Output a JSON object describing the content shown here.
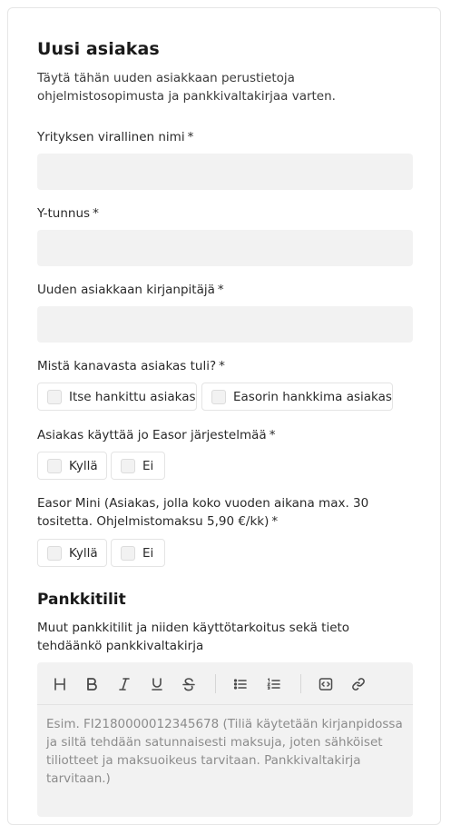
{
  "form": {
    "title": "Uusi asiakas",
    "description": "Täytä tähän uuden asiakkaan perustietoja ohjelmistosopimusta ja pankkivaltakirjaa varten.",
    "required_mark": "*",
    "fields": {
      "company_name": {
        "label": "Yrityksen virallinen nimi",
        "value": ""
      },
      "business_id": {
        "label": "Y-tunnus",
        "value": ""
      },
      "bookkeeper": {
        "label": "Uuden asiakkaan kirjanpitäjä",
        "value": ""
      }
    },
    "channel": {
      "label": "Mistä kanavasta asiakas tuli?",
      "options": [
        "Itse hankittu asiakas",
        "Easorin hankkima asiakas"
      ]
    },
    "uses_easor": {
      "label": "Asiakas käyttää jo Easor järjestelmää",
      "options": [
        "Kyllä",
        "Ei"
      ]
    },
    "easor_mini": {
      "label": "Easor Mini (Asiakas, jolla koko vuoden aikana max. 30 tositetta. Ohjelmistomaksu 5,90 €/kk)",
      "options": [
        "Kyllä",
        "Ei"
      ]
    }
  },
  "bank": {
    "title": "Pankkitilit",
    "label": "Muut pankkitilit ja niiden käyttötarkoitus sekä tieto tehdäänkö pankkivaltakirja",
    "toolbar": [
      "heading-icon",
      "bold-icon",
      "italic-icon",
      "underline-icon",
      "strikethrough-icon",
      "bullet-list-icon",
      "numbered-list-icon",
      "code-block-icon",
      "link-icon"
    ],
    "placeholder": "Esim. FI2180000012345678 (Tiliä käytetään kirjanpidossa ja siltä tehdään satunnaisesti maksuja, joten sähköiset tiliotteet ja maksuoikeus tarvitaan. Pankkivaltakirja tarvitaan.)"
  }
}
